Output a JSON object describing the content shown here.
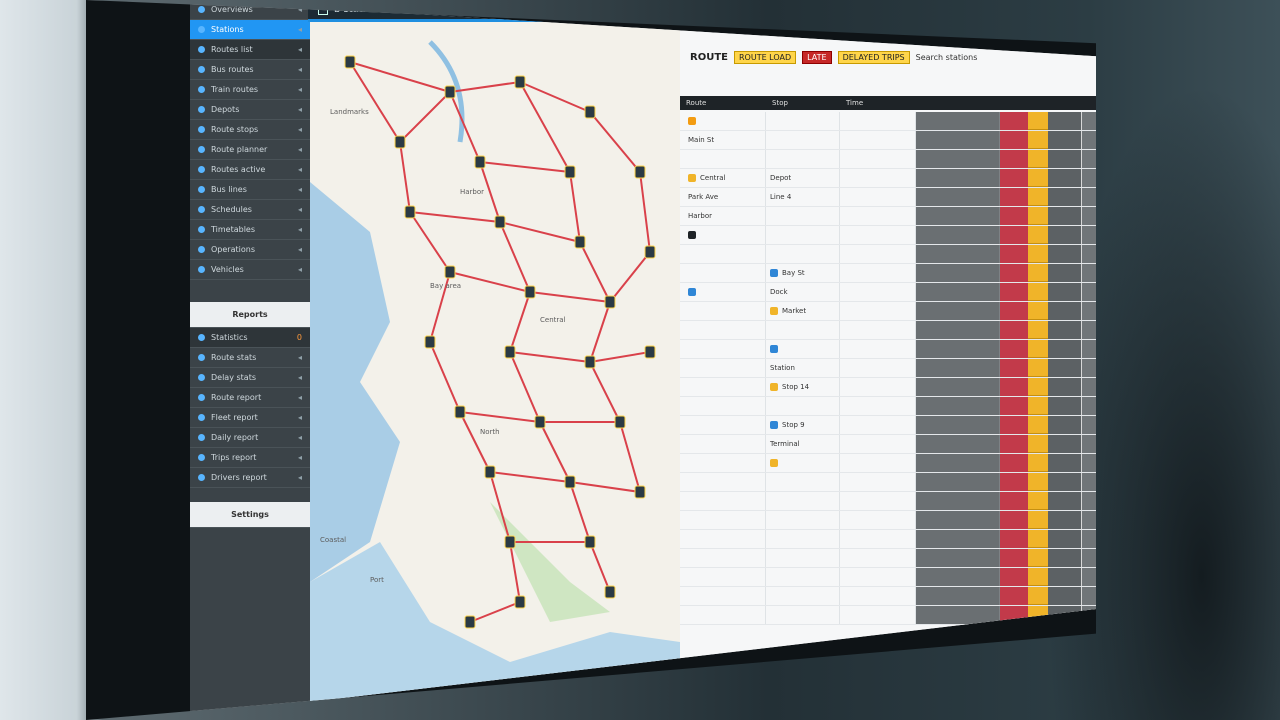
{
  "window": {
    "title": "b stations"
  },
  "sidebar": {
    "items": [
      {
        "label": "Overviews",
        "kind": "top"
      },
      {
        "label": "Stations",
        "kind": "active"
      },
      {
        "label": "Routes list",
        "kind": "dark"
      },
      {
        "label": "Bus routes"
      },
      {
        "label": "Train routes"
      },
      {
        "label": "Depots"
      },
      {
        "label": "Route stops"
      },
      {
        "label": "Route planner"
      },
      {
        "label": "Routes active"
      },
      {
        "label": "Bus lines"
      },
      {
        "label": "Schedules"
      },
      {
        "label": "Timetables"
      },
      {
        "label": "Operations"
      },
      {
        "label": "Vehicles"
      }
    ],
    "section_header": "Reports",
    "section_items": [
      {
        "label": "Statistics",
        "badge": "0"
      },
      {
        "label": "Route stats"
      },
      {
        "label": "Delay stats"
      },
      {
        "label": "Route report"
      },
      {
        "label": "Fleet report"
      },
      {
        "label": "Daily report"
      },
      {
        "label": "Trips report"
      },
      {
        "label": "Drivers report"
      }
    ],
    "footer": "Settings"
  },
  "panel": {
    "title": "ROUTE",
    "chips": [
      {
        "label": "ROUTE LOAD",
        "tone": "yellow"
      },
      {
        "label": "LATE",
        "tone": "red"
      },
      {
        "label": "DELAYED TRIPS",
        "tone": "yellow"
      }
    ],
    "search_text": "Search stations",
    "toolbar_icons": [
      "settings-icon",
      "filter-icon",
      "menu-icon"
    ],
    "columns": [
      "Route",
      "Stop",
      "Time",
      "",
      "",
      ""
    ],
    "rows": [
      {
        "a": "",
        "b": ""
      },
      {
        "a": "Main St",
        "b": ""
      },
      {
        "a": "",
        "b": ""
      },
      {
        "a": "Central",
        "b": "Depot"
      },
      {
        "a": "Park Ave",
        "b": "Line 4"
      },
      {
        "a": "Harbor",
        "b": ""
      },
      {
        "a": "",
        "b": ""
      },
      {
        "a": "",
        "b": ""
      },
      {
        "a": "",
        "b": "Bay St"
      },
      {
        "a": "",
        "b": "Dock"
      },
      {
        "a": "",
        "b": "Market"
      },
      {
        "a": "",
        "b": ""
      },
      {
        "a": "",
        "b": ""
      },
      {
        "a": "",
        "b": "Station"
      },
      {
        "a": "",
        "b": "Stop 14"
      },
      {
        "a": "",
        "b": ""
      },
      {
        "a": "",
        "b": "Stop 9"
      },
      {
        "a": "",
        "b": "Terminal"
      },
      {
        "a": "",
        "b": ""
      },
      {
        "a": "",
        "b": ""
      },
      {
        "a": "",
        "b": ""
      },
      {
        "a": "",
        "b": ""
      },
      {
        "a": "",
        "b": ""
      },
      {
        "a": "",
        "b": ""
      },
      {
        "a": "",
        "b": ""
      },
      {
        "a": "",
        "b": ""
      },
      {
        "a": "",
        "b": ""
      }
    ],
    "status_colors": [
      "#2d2f31",
      "#c94a5c",
      "#3aa86b",
      "#3aa86b",
      "#c94a5c",
      "#c94a5c",
      "#3aa86b",
      "#2aa7c9",
      "#c94a5c",
      "#c94a5c",
      "#f0b429",
      "#f0b429",
      "#f0b429",
      "#f0b429",
      "#3aa86b",
      "#3aa86b",
      "#3aa86b"
    ]
  },
  "map": {
    "labels": [
      "Landmarks",
      "Harbor",
      "Bay area",
      "Coastal",
      "Port",
      "North",
      "Central"
    ]
  }
}
